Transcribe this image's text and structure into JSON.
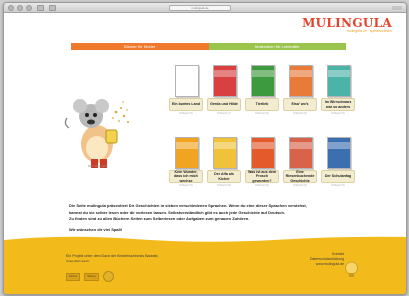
{
  "browser": {
    "address": "mulingula.de"
  },
  "logo": {
    "word": "MULINGULA",
    "tagline": "mulingula.ch · spielend lesen"
  },
  "nav": {
    "books_label": "Bücher für Kinder",
    "materials_label": "Materialien für Lehrkräfte"
  },
  "illustration": {
    "caption": "Bild: Mulingula"
  },
  "books": [
    {
      "title": "Ein buntes Land",
      "sub": "Hörbuch (8)",
      "color": "#ffffff"
    },
    {
      "title": "Gerda und Hilde",
      "sub": "Hörbuch (7)",
      "color": "#d94040"
    },
    {
      "title": "Tierlieb",
      "sub": "Hörbuch (8)",
      "color": "#3e9a3e"
    },
    {
      "title": "Eisa' wo's",
      "sub": "Hörbuch (8)",
      "color": "#e87a3a"
    },
    {
      "title": "Im Wirrschwarz war so anders",
      "sub": "Hörbuch (8)",
      "color": "#4bb3a8"
    },
    {
      "title": "Kein Wunder, dass ich mich wechse",
      "sub": "Hörbuch (8)",
      "color": "#f1a322"
    },
    {
      "title": "Der Alfa als Kicher",
      "sub": "Hörbuch (8)",
      "color": "#f0c23a"
    },
    {
      "title": "Was ist aus dem Frosch geworden?",
      "sub": "Hörbuch (8)",
      "color": "#e45a2a"
    },
    {
      "title": "Eine Riesenbuchende Geschichte",
      "sub": "Hörbuch (8)",
      "color": "#d8634a"
    },
    {
      "title": "Der Schulanfag",
      "sub": "Hörbuch (8)",
      "color": "#3c6fb0"
    }
  ],
  "intro": {
    "p1": "Die Seite mulingula präsentiert Dir Geschichten in sieben verschiedenen Sprachen. Wenn du eine dieser Sprachen verstehst,",
    "p2": "kannst du sie selber lesen oder dir vorlesen lassen. Selbstverständlich gibt es auch jede Geschichte auf Deutsch.",
    "p3": "Zu finden sind zu allen Büchern Seiten zum Selberlesen oder Aufgaben zum genauen Zuhören.",
    "greeting": "Wir wünschen dir viel Spaß!"
  },
  "footer": {
    "line1": "Ein Projekt unter dem Dach der Kinderbuchfonds Baobab,",
    "line2": "Unterstützt durch:",
    "partner_1": "Partner",
    "partner_2": "Stiftung",
    "right_1": "Kontakt",
    "right_2": "Datenschutzerklärung",
    "right_3": "www.mulingula.de"
  },
  "colors": {
    "accent_orange": "#f07a2c",
    "accent_green": "#9bc44c",
    "footer_yellow": "#f2ba1b",
    "logo_red": "#e3432a"
  }
}
